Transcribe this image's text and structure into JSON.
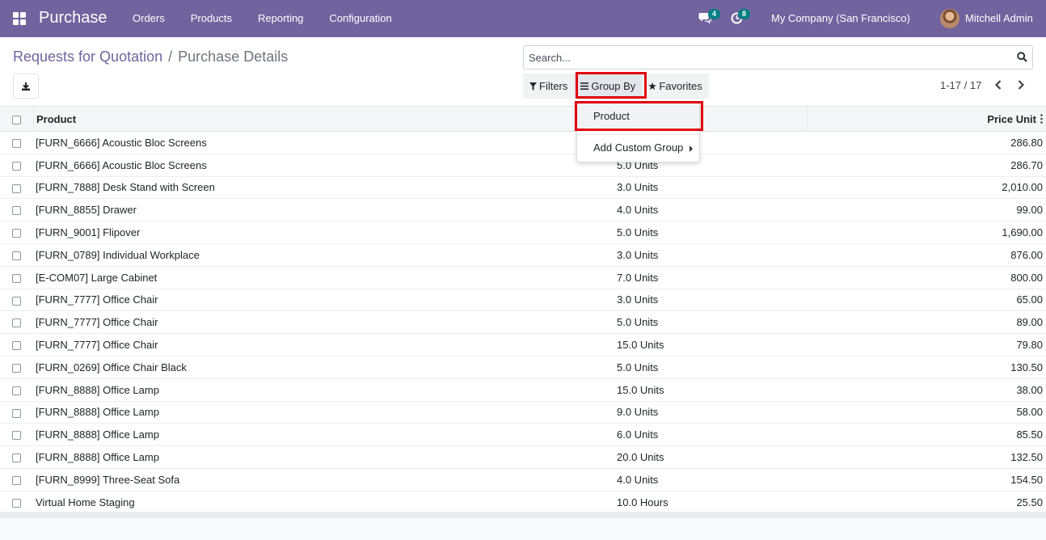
{
  "navbar": {
    "app_title": "Purchase",
    "menu": [
      "Orders",
      "Products",
      "Reporting",
      "Configuration"
    ],
    "chat_count": "4",
    "activity_count": "8",
    "company": "My Company (San Francisco)",
    "user": "Mitchell Admin"
  },
  "breadcrumb": {
    "parent": "Requests for Quotation",
    "separator": "/",
    "current": "Purchase Details"
  },
  "search": {
    "placeholder": "Search..."
  },
  "filters": {
    "filters_label": "Filters",
    "group_by_label": "Group By",
    "favorites_label": "Favorites"
  },
  "pager": {
    "text": "1-17 / 17"
  },
  "group_by_menu": {
    "product_label": "Product",
    "custom_group_label": "Add Custom Group"
  },
  "table": {
    "columns": {
      "product": "Product",
      "price_unit": "Price Unit"
    },
    "rows": [
      {
        "product": "[FURN_6666] Acoustic Bloc Screens",
        "qty": "",
        "price": "286.80"
      },
      {
        "product": "[FURN_6666] Acoustic Bloc Screens",
        "qty": "5.0 Units",
        "price": "286.70"
      },
      {
        "product": "[FURN_7888] Desk Stand with Screen",
        "qty": "3.0 Units",
        "price": "2,010.00"
      },
      {
        "product": "[FURN_8855] Drawer",
        "qty": "4.0 Units",
        "price": "99.00"
      },
      {
        "product": "[FURN_9001] Flipover",
        "qty": "5.0 Units",
        "price": "1,690.00"
      },
      {
        "product": "[FURN_0789] Individual Workplace",
        "qty": "3.0 Units",
        "price": "876.00"
      },
      {
        "product": "[E-COM07] Large Cabinet",
        "qty": "7.0 Units",
        "price": "800.00"
      },
      {
        "product": "[FURN_7777] Office Chair",
        "qty": "3.0 Units",
        "price": "65.00"
      },
      {
        "product": "[FURN_7777] Office Chair",
        "qty": "5.0 Units",
        "price": "89.00"
      },
      {
        "product": "[FURN_7777] Office Chair",
        "qty": "15.0 Units",
        "price": "79.80"
      },
      {
        "product": "[FURN_0269] Office Chair Black",
        "qty": "5.0 Units",
        "price": "130.50"
      },
      {
        "product": "[FURN_8888] Office Lamp",
        "qty": "15.0 Units",
        "price": "38.00"
      },
      {
        "product": "[FURN_8888] Office Lamp",
        "qty": "9.0 Units",
        "price": "58.00"
      },
      {
        "product": "[FURN_8888] Office Lamp",
        "qty": "6.0 Units",
        "price": "85.50"
      },
      {
        "product": "[FURN_8888] Office Lamp",
        "qty": "20.0 Units",
        "price": "132.50"
      },
      {
        "product": "[FURN_8999] Three-Seat Sofa",
        "qty": "4.0 Units",
        "price": "154.50"
      },
      {
        "product": "Virtual Home Staging",
        "qty": "10.0 Hours",
        "price": "25.50"
      }
    ]
  }
}
